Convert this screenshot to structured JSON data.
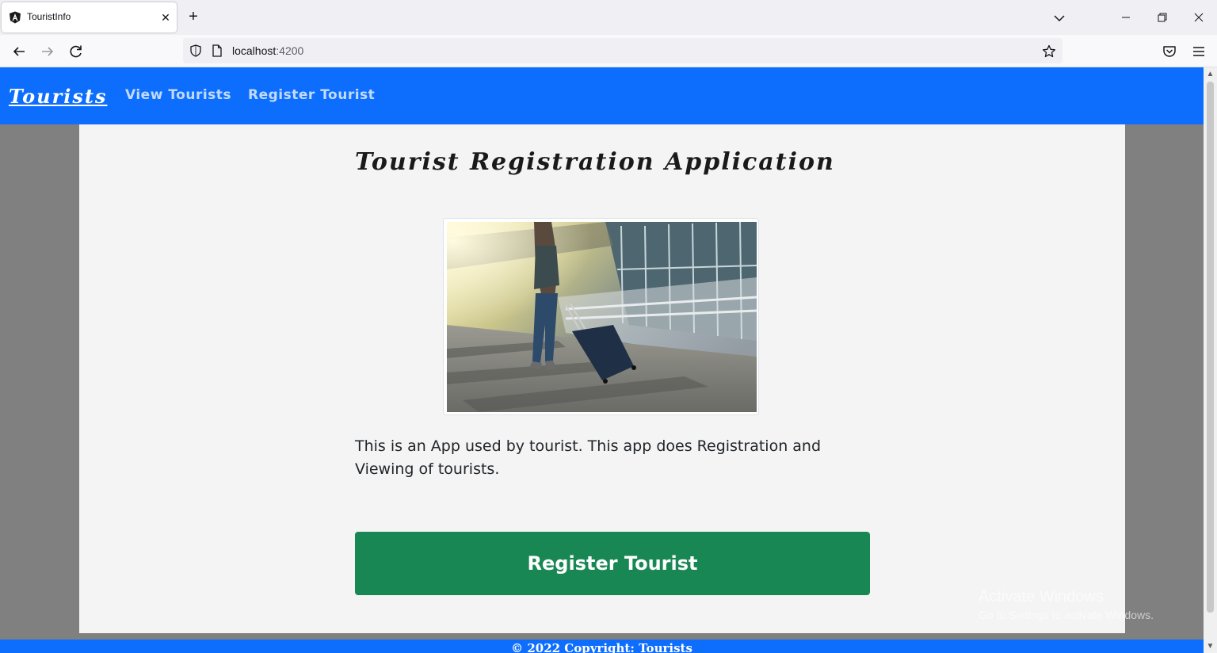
{
  "browser": {
    "tab": {
      "title": "TouristInfo",
      "close": "✕"
    },
    "new_tab": "+",
    "url": {
      "host": "localhost",
      "port": ":4200"
    }
  },
  "app": {
    "brand": "Tourists",
    "nav": [
      {
        "label": "View Tourists"
      },
      {
        "label": "Register Tourist"
      }
    ],
    "heading": "Tourist Registration Application",
    "description": "This is an App used by tourist. This app does Registration and Viewing of tourists.",
    "cta_label": "Register Tourist",
    "footer": "© 2022 Copyright: Tourists"
  },
  "os_watermark": {
    "line1": "Activate Windows",
    "line2": "Go to Settings to activate Windows."
  },
  "colors": {
    "primary": "#0d6efd",
    "success": "#198754",
    "page_bg": "#808080",
    "content_bg": "#f4f4f4"
  }
}
